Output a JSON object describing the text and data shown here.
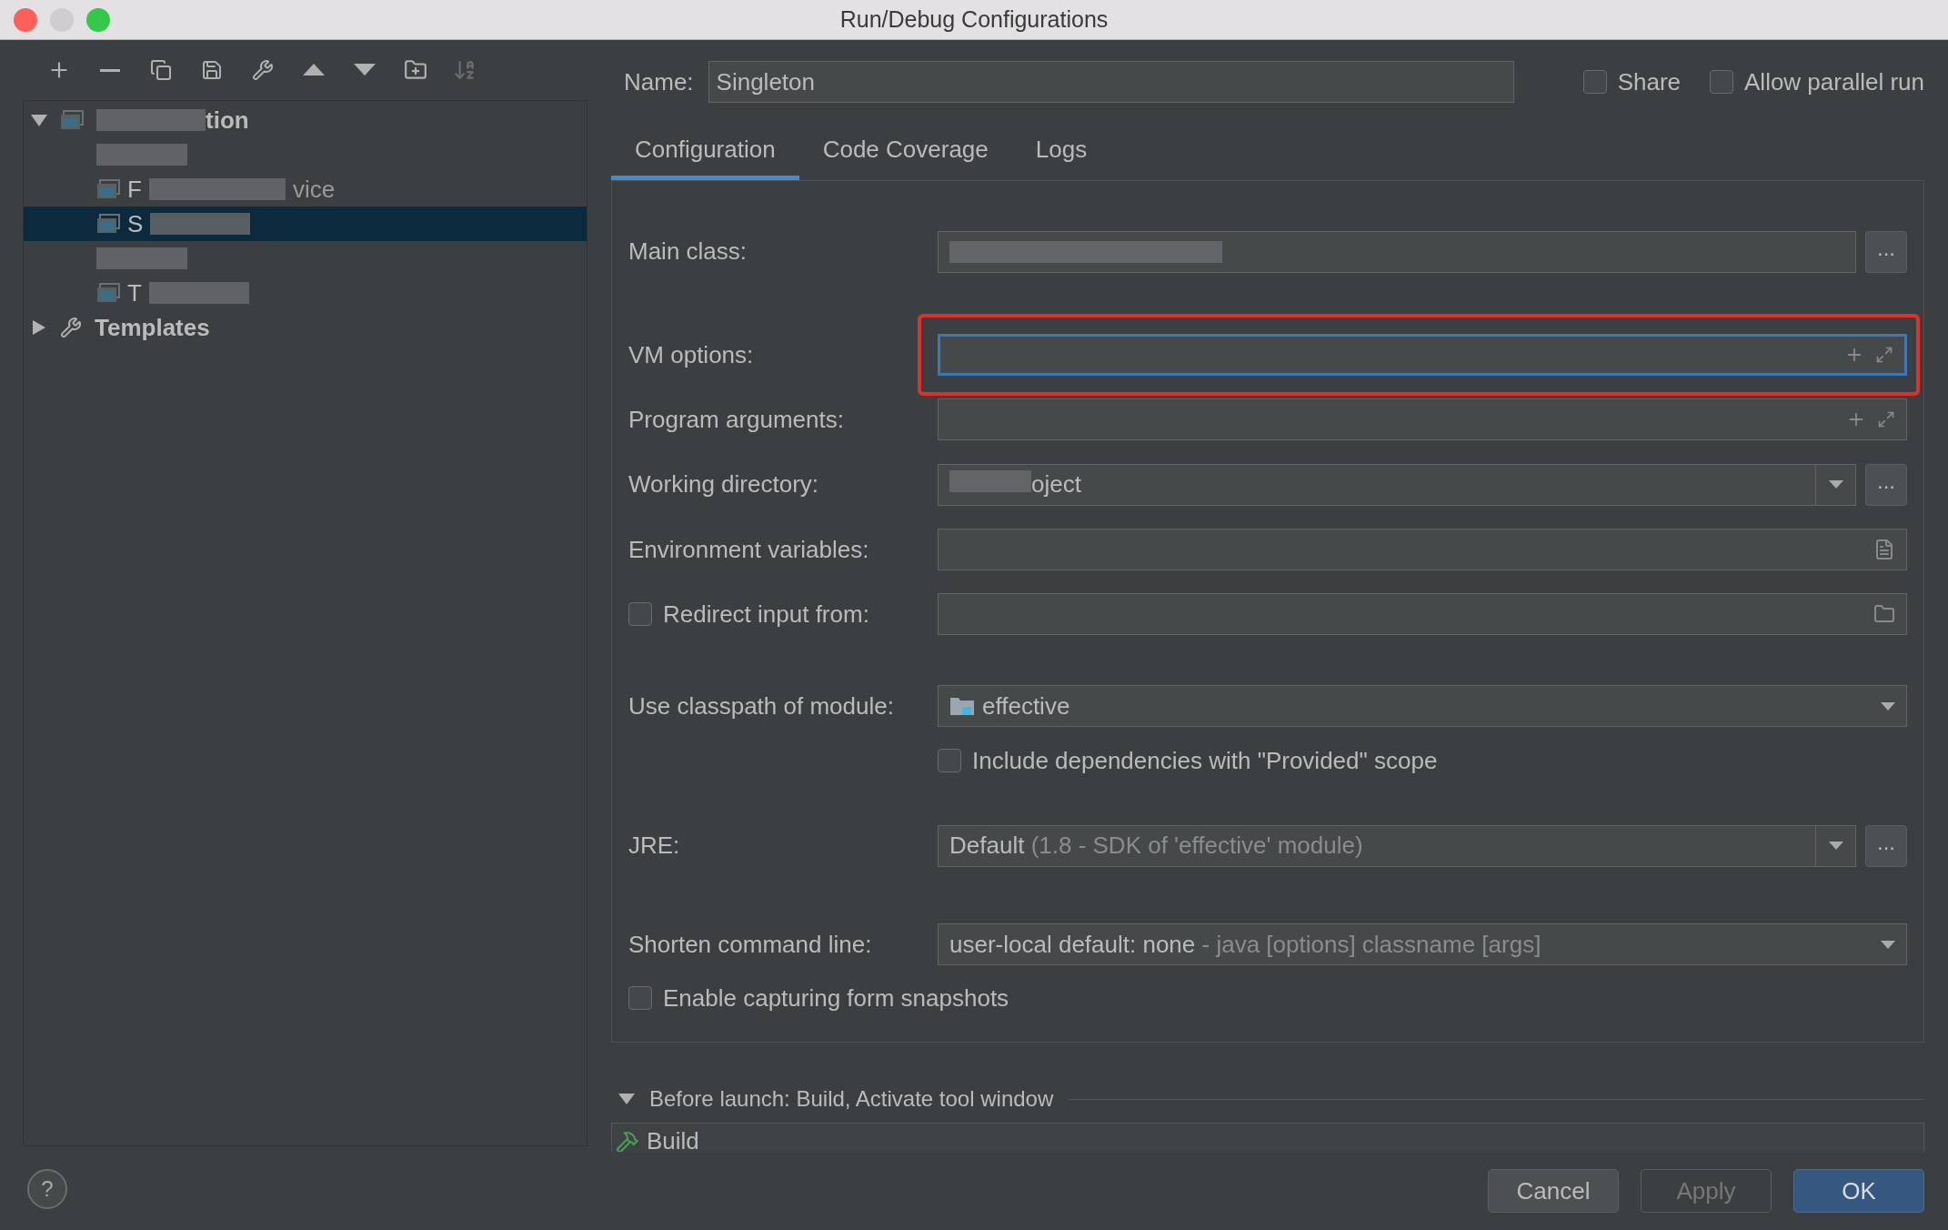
{
  "window": {
    "title": "Run/Debug Configurations"
  },
  "tree": {
    "root": {
      "parts": [
        "tion"
      ],
      "expanded": true,
      "children": [
        {
          "kind": "redacted",
          "selected": false
        },
        {
          "kind": "config",
          "parts": [
            "F",
            "vice"
          ],
          "selected": false
        },
        {
          "kind": "config",
          "parts": [
            "S"
          ],
          "selected": true
        },
        {
          "kind": "redacted",
          "selected": false
        },
        {
          "kind": "config",
          "parts": [
            "T"
          ],
          "selected": false
        }
      ]
    },
    "templates": {
      "label": "Templates",
      "expanded": false
    }
  },
  "name_field": {
    "label": "Name:",
    "value": "Singleton"
  },
  "options": [
    {
      "label": "Share",
      "checked": false
    },
    {
      "label": "Allow parallel run",
      "checked": false
    }
  ],
  "tabs": [
    {
      "label": "Configuration",
      "selected": true
    },
    {
      "label": "Code Coverage",
      "selected": false
    },
    {
      "label": "Logs",
      "selected": false
    }
  ],
  "fields": [
    {
      "kind": "redacted_browse",
      "label": "Main class:",
      "browse_button": "..."
    },
    {
      "kind": "expand",
      "label": "VM options:",
      "focused": true,
      "highlighted": true
    },
    {
      "kind": "expand",
      "label": "Program arguments:",
      "focused": false,
      "highlighted": false
    },
    {
      "kind": "combo_browse",
      "label": "Working directory:",
      "value": "oject",
      "browse_button": "..."
    },
    {
      "kind": "env",
      "label": "Environment variables:"
    },
    {
      "kind": "redirect",
      "label": "Redirect input from:",
      "checked": false
    },
    {
      "kind": "module",
      "label": "Use classpath of module:",
      "value": "effective"
    },
    {
      "kind": "checkbox",
      "label": "Include dependencies with \"Provided\" scope",
      "checked": false
    },
    {
      "kind": "combo_browse",
      "label": "JRE:",
      "value": "Default",
      "hint": "(1.8 - SDK of 'effective' module)",
      "browse_button": "..."
    },
    {
      "kind": "combo",
      "label": "Shorten command line:",
      "value": "user-local default: none",
      "hint": "- java [options] classname [args]"
    },
    {
      "kind": "wide_checkbox",
      "label": "Enable capturing form snapshots",
      "checked": false
    }
  ],
  "before_launch": {
    "title": "Before launch: Build, Activate tool window",
    "expanded": true,
    "tasks": [
      "Build"
    ]
  },
  "help": "?",
  "buttons": [
    {
      "label": "Cancel",
      "kind": "normal"
    },
    {
      "label": "Apply",
      "kind": "disabled"
    },
    {
      "label": "OK",
      "kind": "default"
    }
  ]
}
